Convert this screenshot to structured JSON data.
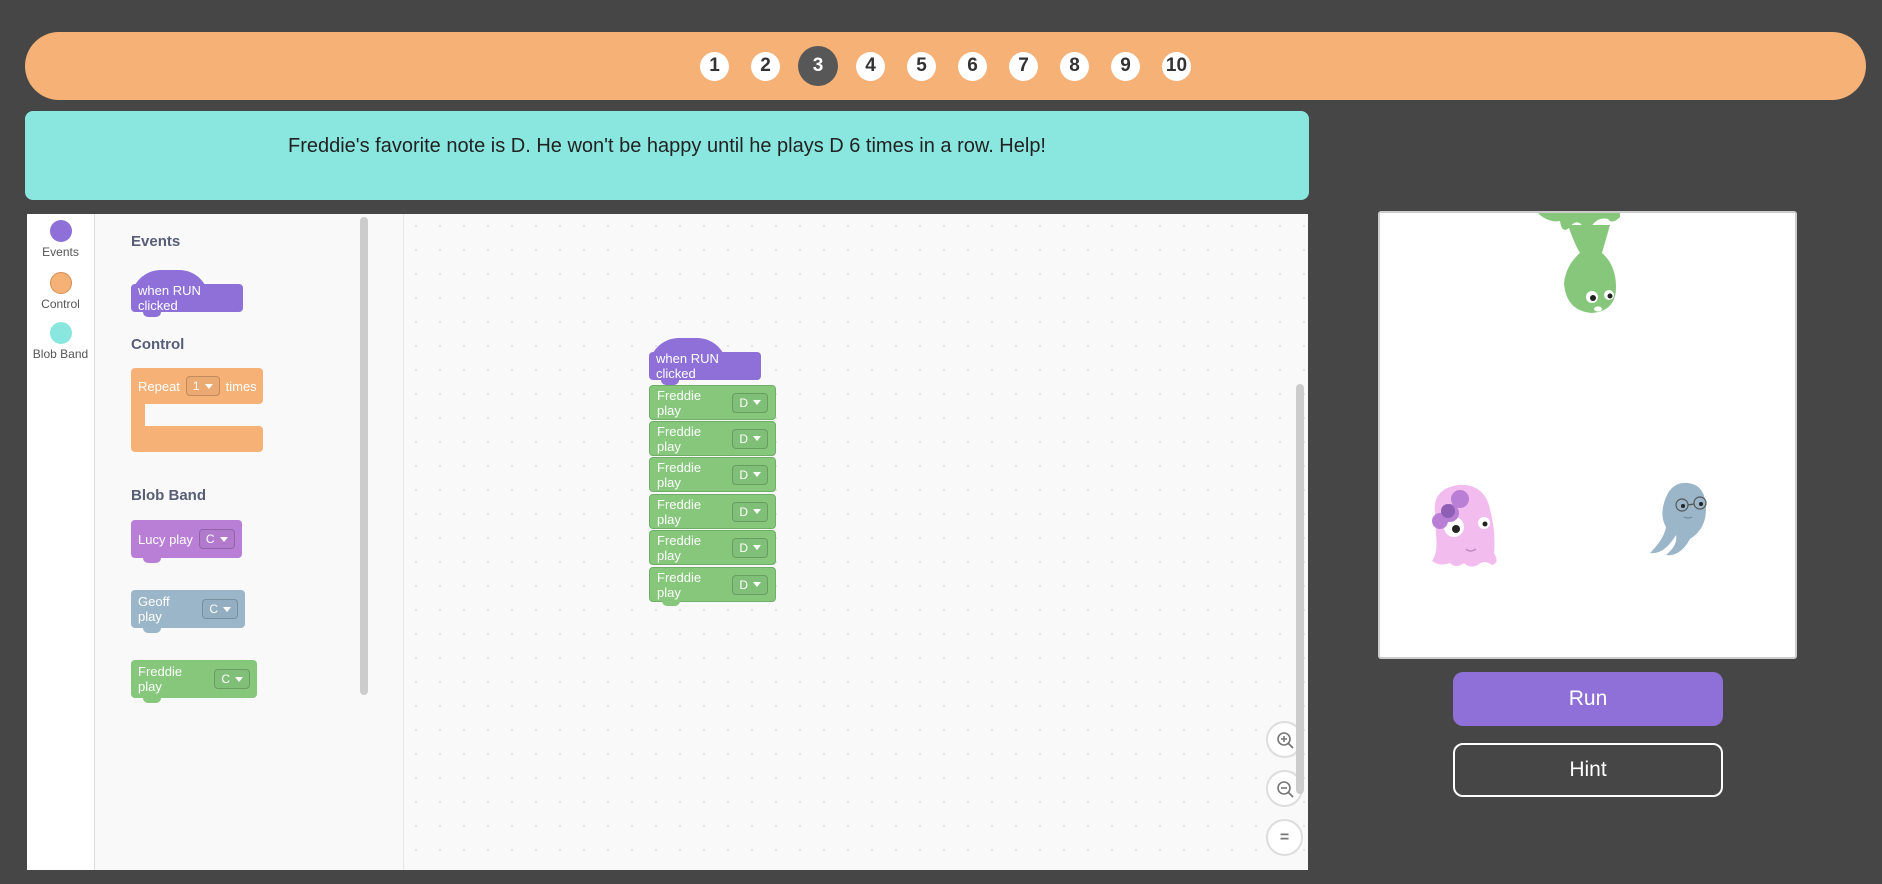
{
  "levels": [
    "1",
    "2",
    "3",
    "4",
    "5",
    "6",
    "7",
    "8",
    "9",
    "10"
  ],
  "current_level": "3",
  "instructions": "Freddie's favorite note is D. He won't be happy until he plays D 6 times in a row. Help!",
  "categories": [
    {
      "label": "Events",
      "color": "#8e70d8"
    },
    {
      "label": "Control",
      "color": "#f5b176"
    },
    {
      "label": "Blob Band",
      "color": "#89e7e0"
    }
  ],
  "flyout": {
    "events_title": "Events",
    "when_run": "when RUN clicked",
    "control_title": "Control",
    "repeat_label": "Repeat",
    "repeat_value": "1",
    "times_label": "times",
    "blob_title": "Blob Band",
    "lucy_label": "Lucy play",
    "lucy_note": "C",
    "geoff_label": "Geoff play",
    "geoff_note": "C",
    "freddie_label": "Freddie play",
    "freddie_note": "C"
  },
  "script": {
    "hat_label": "when RUN clicked",
    "freddie_label": "Freddie play",
    "notes": [
      "D",
      "D",
      "D",
      "D",
      "D",
      "D"
    ]
  },
  "buttons": {
    "run": "Run",
    "hint": "Hint"
  },
  "zoom": {
    "reset_symbol": "="
  }
}
